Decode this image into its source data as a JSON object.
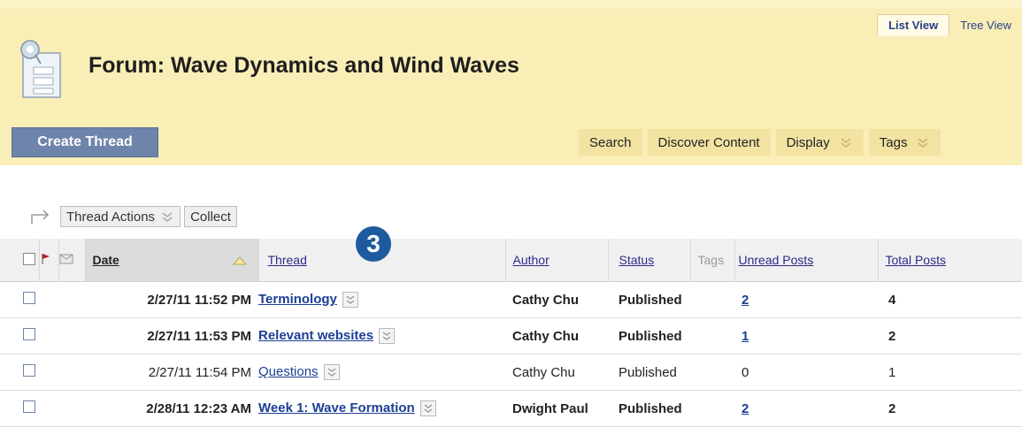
{
  "views": {
    "list": "List View",
    "tree": "Tree View"
  },
  "forum": {
    "title": "Forum: Wave Dynamics and Wind Waves",
    "icon": "forum-icon"
  },
  "toolbar": {
    "create_thread": "Create Thread",
    "search": "Search",
    "discover": "Discover Content",
    "display": "Display",
    "tags": "Tags"
  },
  "actions": {
    "thread_actions": "Thread Actions",
    "collect": "Collect"
  },
  "table": {
    "headers": {
      "date": "Date",
      "thread": "Thread",
      "author": "Author",
      "status": "Status",
      "tags": "Tags",
      "unread": "Unread Posts",
      "total": "Total Posts"
    },
    "rows": [
      {
        "date": "2/27/11 11:52 PM",
        "thread": "Terminology",
        "author": "Cathy Chu",
        "status": "Published",
        "unread": "2",
        "total": "4",
        "bold": true
      },
      {
        "date": "2/27/11 11:53 PM",
        "thread": "Relevant websites",
        "author": "Cathy Chu",
        "status": "Published",
        "unread": "1",
        "total": "2",
        "bold": true
      },
      {
        "date": "2/27/11 11:54 PM",
        "thread": "Questions",
        "author": "Cathy Chu",
        "status": "Published",
        "unread": "0",
        "total": "1",
        "bold": false
      },
      {
        "date": "2/28/11 12:23 AM",
        "thread": "Week 1: Wave Formation",
        "author": "Dwight Paul",
        "status": "Published",
        "unread": "2",
        "total": "2",
        "bold": true
      }
    ]
  },
  "callout": "3",
  "colors": {
    "band": "#faeeb7",
    "create_button": "#6f84ab",
    "link": "#1c3f95",
    "badge": "#1e5b9e"
  }
}
